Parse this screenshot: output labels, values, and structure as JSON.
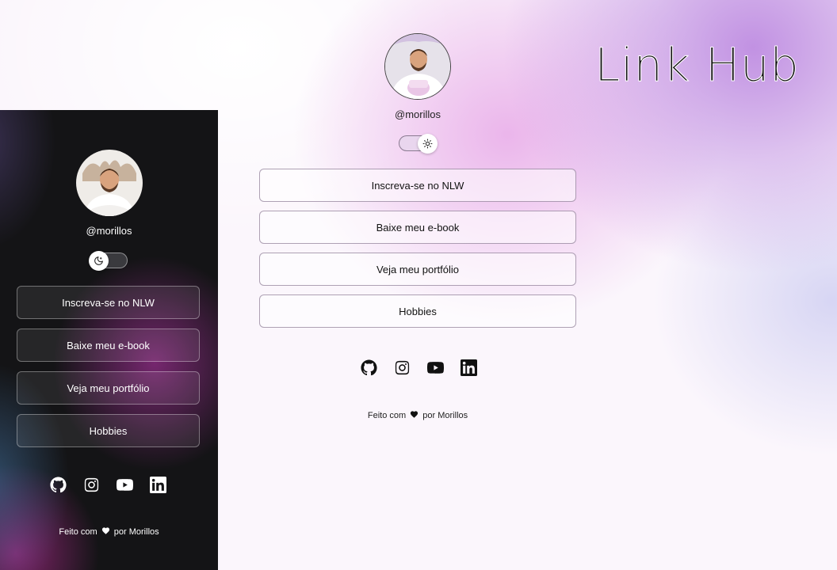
{
  "title": "Link Hub",
  "dark_theme": {
    "username": "@morillos",
    "links": [
      "Inscreva-se no NLW",
      "Baixe meu e-book",
      "Veja meu portfólio",
      "Hobbies"
    ],
    "footer": {
      "before": "Feito com",
      "after": "por Morillos"
    },
    "socials": [
      "github-icon",
      "instagram-icon",
      "youtube-icon",
      "linkedin-icon"
    ],
    "toggle_icon": "moon-icon"
  },
  "light_theme": {
    "username": "@morillos",
    "links": [
      "Inscreva-se no NLW",
      "Baixe meu e-book",
      "Veja meu portfólio",
      "Hobbies"
    ],
    "footer": {
      "before": "Feito com",
      "after": "por Morillos"
    },
    "socials": [
      "github-icon",
      "instagram-icon",
      "youtube-icon",
      "linkedin-icon"
    ],
    "toggle_icon": "sun-icon"
  },
  "colors": {
    "dark_bg": "#141416",
    "accent_purple": "#be8ce1",
    "accent_pink": "#e8aae8"
  }
}
